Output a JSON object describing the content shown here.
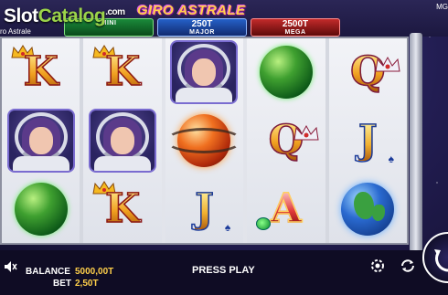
{
  "watermark": {
    "part1": "Slot",
    "part2": "Catalog",
    "suffix": ".com"
  },
  "game_logo": "GIRO ASTRALE",
  "window_title": "ro Astrale",
  "corner_label": "MG",
  "jackpots": [
    {
      "id": "mini",
      "value": "",
      "label": "MINI"
    },
    {
      "id": "major",
      "value": "250T",
      "label": "MAJOR"
    },
    {
      "id": "mega",
      "value": "2500T",
      "label": "MEGA"
    }
  ],
  "reels": [
    [
      "K",
      "astronaut",
      "green-planet"
    ],
    [
      "K",
      "astronaut",
      "K"
    ],
    [
      "astronaut",
      "red-planet",
      "J"
    ],
    [
      "green-planet",
      "Q",
      "A"
    ],
    [
      "Q",
      "J",
      "earth-planet"
    ]
  ],
  "bottom": {
    "balance_label": "BALANCE",
    "balance_value": "5000,00T",
    "bet_label": "BET",
    "bet_value": "2,50T",
    "press_play": "PRESS PLAY"
  },
  "icons": [
    "sound-icon",
    "autoplay-icon",
    "turbo-icon",
    "spin-icon",
    "crown-icon",
    "spade-icon",
    "gem-icon"
  ],
  "colors": {
    "jackpot_mini": "#1a8a3a",
    "jackpot_major": "#2560c8",
    "jackpot_mega": "#c22a2a",
    "balance_value": "#ffd04a"
  }
}
